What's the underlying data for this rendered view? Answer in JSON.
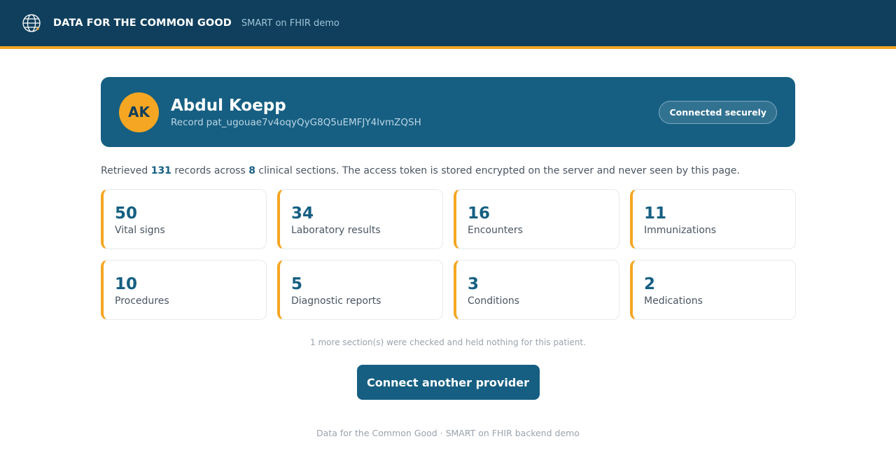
{
  "header": {
    "globe_icon": "globe-icon",
    "brand": "DATA FOR THE COMMON GOOD",
    "subtitle": "SMART on FHIR demo"
  },
  "patient": {
    "initials": "AK",
    "name": "Abdul Koepp",
    "record_label": "Record",
    "record_id": "pat_ugouae7v4oqyQyG8Q5uEMFJY4lvmZQSH",
    "status": "Connected securely"
  },
  "summary": {
    "prefix": "Retrieved",
    "records": "131",
    "middle": "records across",
    "sections": "8",
    "suffix": "clinical sections. The access token is stored encrypted on the server and never seen by this page."
  },
  "tiles": [
    {
      "count": "50",
      "label": "Vital signs"
    },
    {
      "count": "34",
      "label": "Laboratory results"
    },
    {
      "count": "16",
      "label": "Encounters"
    },
    {
      "count": "11",
      "label": "Immunizations"
    },
    {
      "count": "10",
      "label": "Procedures"
    },
    {
      "count": "5",
      "label": "Diagnostic reports"
    },
    {
      "count": "3",
      "label": "Conditions"
    },
    {
      "count": "2",
      "label": "Medications"
    }
  ],
  "note": "1 more section(s) were checked and held nothing for this patient.",
  "cta_label": "Connect another provider",
  "footer": "Data for the Common Good · SMART on FHIR backend demo",
  "colors": {
    "header_bg": "#0f3f5c",
    "accent": "#f5a623",
    "card_bg": "#165f82"
  }
}
